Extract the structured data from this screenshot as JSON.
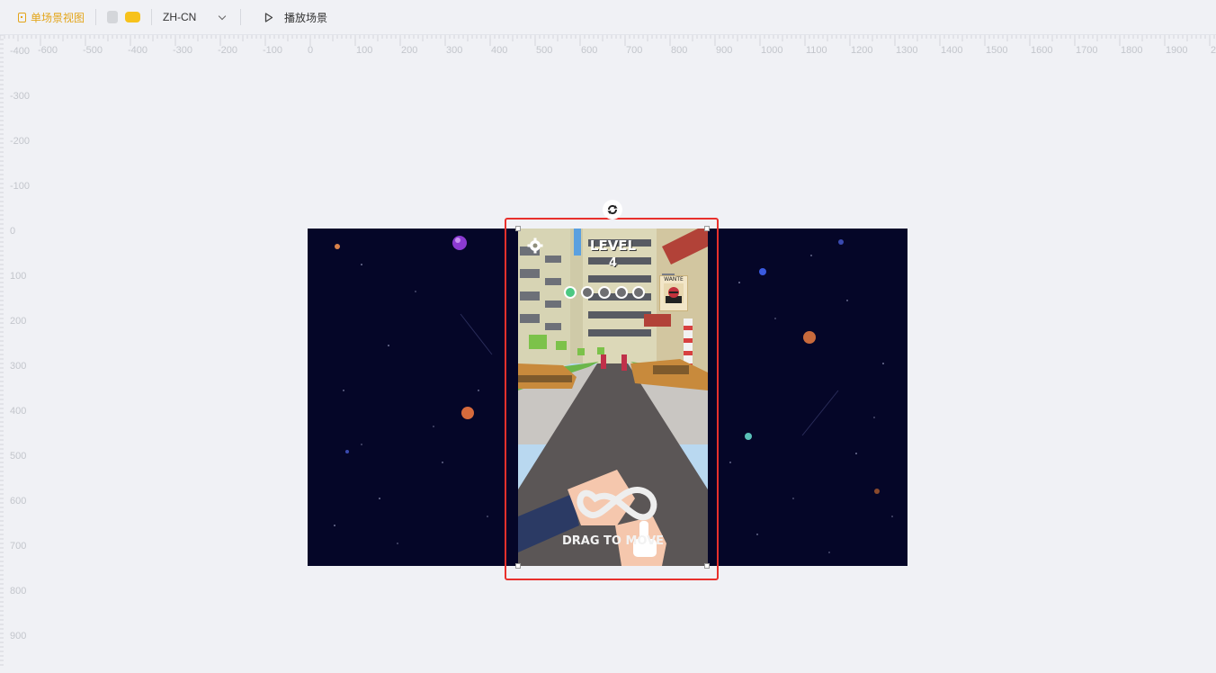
{
  "toolbar": {
    "scene_view_label": "单场景视图",
    "language": "ZH-CN",
    "play_label": "播放场景",
    "accent_color": "#e3a51a"
  },
  "ruler_h": [
    "-600",
    "-500",
    "-400",
    "-300",
    "-200",
    "-100",
    "0",
    "100",
    "200",
    "300",
    "400",
    "500",
    "600",
    "700",
    "800",
    "900",
    "1000",
    "1100",
    "1200",
    "1300",
    "1400",
    "1500",
    "1600",
    "1700",
    "1800",
    "1900",
    "20"
  ],
  "ruler_v": [
    "-400",
    "-300",
    "-200",
    "-100",
    "0",
    "100",
    "200",
    "300",
    "400",
    "500",
    "600",
    "700",
    "800",
    "900"
  ],
  "game": {
    "level_label": "LEVEL",
    "level_number": "4",
    "wanted_label": "WANTE",
    "hint": "DRAG TO MOVE",
    "progress": {
      "completed": 1,
      "total": 5
    },
    "selection_color": "#e8302c"
  }
}
